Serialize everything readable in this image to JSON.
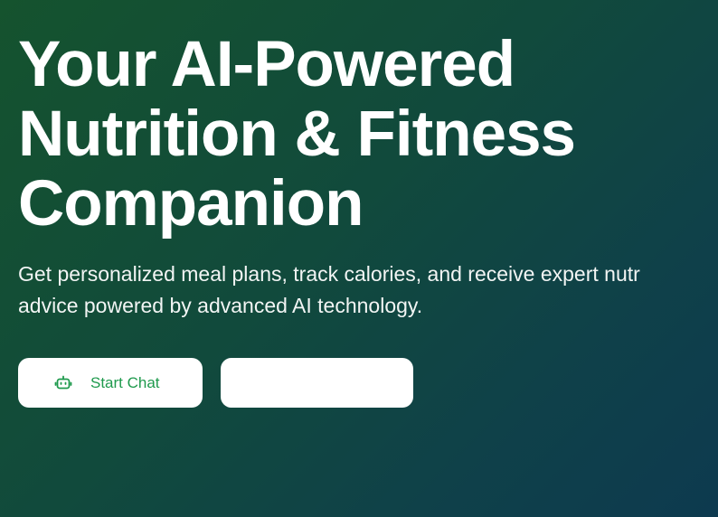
{
  "hero": {
    "title_lines": [
      "Your AI-Powered",
      "Nutrition & Fitness",
      "Companion"
    ],
    "subtitle_lines": [
      "Get personalized meal plans, track calories, and receive expert nutr",
      "advice powered by advanced AI technology."
    ]
  },
  "actions": {
    "start_chat": {
      "label": "Start Chat",
      "icon": "robot-icon"
    },
    "secondary": {
      "label": ""
    }
  },
  "colors": {
    "background_start": "#15532e",
    "background_end": "#0d3a4f",
    "accent": "#1f9a4d",
    "button_bg": "#ffffff"
  }
}
